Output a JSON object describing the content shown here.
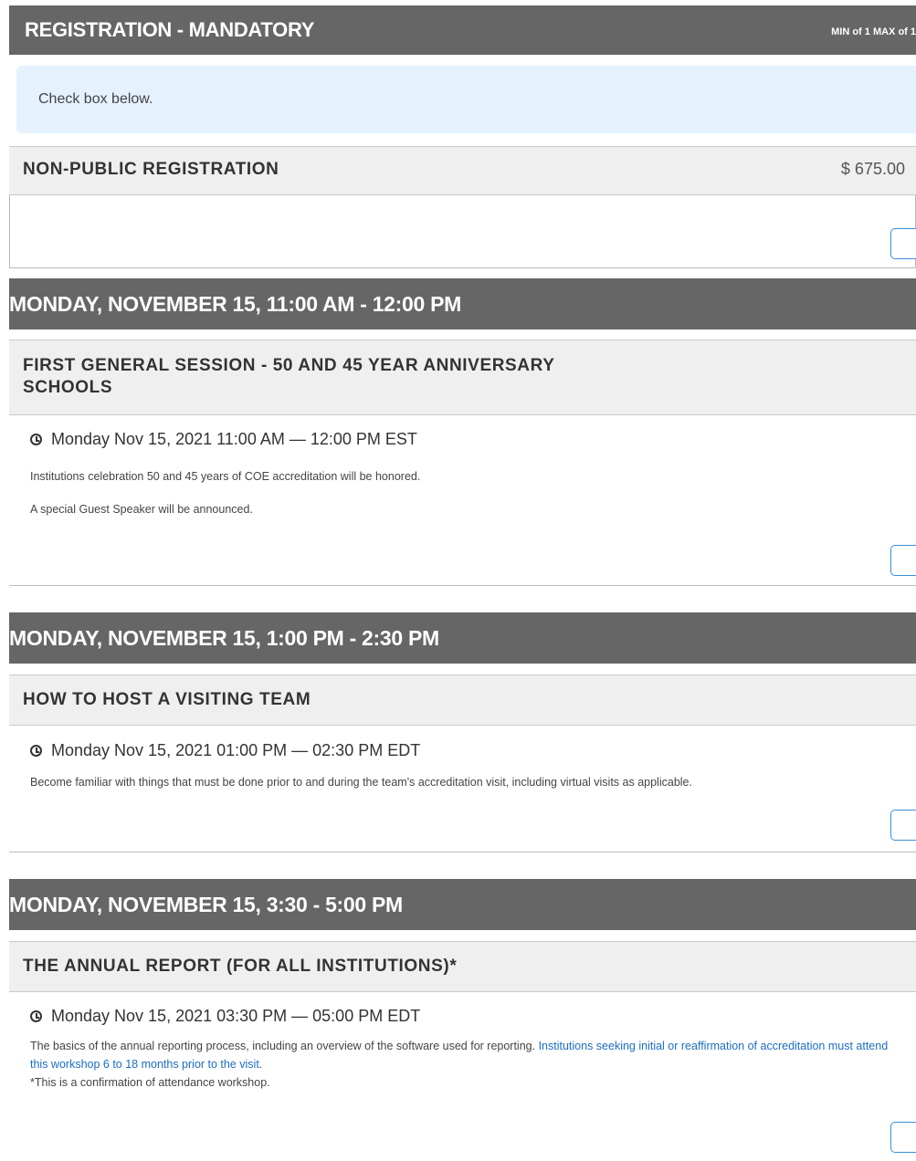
{
  "registration": {
    "title": "REGISTRATION - MANDATORY",
    "min_max": "MIN of 1 MAX of 1",
    "info_text": "Check box below.",
    "item": {
      "name": "NON-PUBLIC REGISTRATION",
      "price": "$ 675.00"
    }
  },
  "sessions": [
    {
      "day_header": "MONDAY, NOVEMBER 15, 11:00 AM - 12:00 PM",
      "title_line1": "FIRST GENERAL SESSION - 50 AND 45 YEAR ANNIVERSARY",
      "title_line2": "SCHOOLS",
      "time": "Monday Nov 15, 2021 11:00 AM — 12:00 PM EST",
      "desc1": "Institutions celebration 50 and 45 years of COE accreditation will be honored.",
      "desc2": "A special Guest Speaker will be announced."
    },
    {
      "day_header": "MONDAY, NOVEMBER 15, 1:00 PM - 2:30 PM",
      "title": "HOW TO HOST A VISITING TEAM",
      "time": "Monday Nov 15, 2021 01:00 PM — 02:30 PM EDT",
      "desc1": "Become familiar with things that must be done prior to and during the team's accreditation visit, including virtual visits as applicable."
    },
    {
      "day_header": "MONDAY, NOVEMBER 15, 3:30 - 5:00 PM",
      "title": "THE ANNUAL REPORT (FOR ALL INSTITUTIONS)*",
      "time": "Monday Nov 15, 2021 03:30 PM — 05:00 PM EDT",
      "desc_plain": "The basics of the annual reporting process, including an overview of the software used for reporting. ",
      "desc_link": "Institutions seeking initial or reaffirmation of accreditation must attend this workshop 6 to 18 months prior to the visit.",
      "desc_note": "*This is a confirmation of attendance workshop."
    }
  ],
  "colors": {
    "header_bg": "#666666",
    "info_bg": "#e5f1fd",
    "link": "#1c6dc2",
    "checkbox_border": "#3b8fd6"
  }
}
